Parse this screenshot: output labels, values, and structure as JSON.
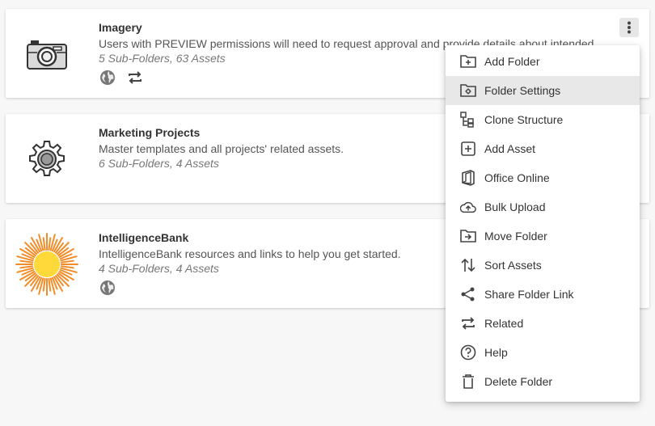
{
  "folders": [
    {
      "title": "Imagery",
      "description": "Users with PREVIEW permissions will need to request approval and provide details about intended",
      "meta": "5 Sub-Folders, 63 Assets",
      "thumb_icon": "camera-icon",
      "badges": [
        "globe-icon",
        "repeat-icon"
      ]
    },
    {
      "title": "Marketing Projects",
      "description": "Master templates and all projects' related assets.",
      "meta": "6 Sub-Folders, 4 Assets",
      "thumb_icon": "gear-icon",
      "badges": []
    },
    {
      "title": "IntelligenceBank",
      "description": "IntelligenceBank resources and links to help you get started.",
      "meta": "4 Sub-Folders, 4 Assets",
      "thumb_icon": "sun-logo-icon",
      "badges": [
        "globe-icon"
      ]
    }
  ],
  "menu": {
    "items": [
      {
        "label": "Add Folder",
        "icon": "add-folder-icon"
      },
      {
        "label": "Folder Settings",
        "icon": "folder-settings-icon",
        "highlighted": true
      },
      {
        "label": "Clone Structure",
        "icon": "clone-structure-icon"
      },
      {
        "label": "Add Asset",
        "icon": "add-asset-icon"
      },
      {
        "label": "Office Online",
        "icon": "office-icon"
      },
      {
        "label": "Bulk Upload",
        "icon": "cloud-upload-icon"
      },
      {
        "label": "Move Folder",
        "icon": "move-folder-icon"
      },
      {
        "label": "Sort Assets",
        "icon": "sort-icon"
      },
      {
        "label": "Share Folder Link",
        "icon": "share-icon"
      },
      {
        "label": "Related",
        "icon": "repeat-icon"
      },
      {
        "label": "Help",
        "icon": "help-icon"
      },
      {
        "label": "Delete Folder",
        "icon": "trash-icon"
      }
    ]
  },
  "colors": {
    "background": "#f7f7f7",
    "card": "#ffffff",
    "menu_highlight": "#e8e8e8",
    "icon_gray": "#555555",
    "sun_orange": "#f28c28",
    "sun_yellow": "#ffd83a"
  }
}
